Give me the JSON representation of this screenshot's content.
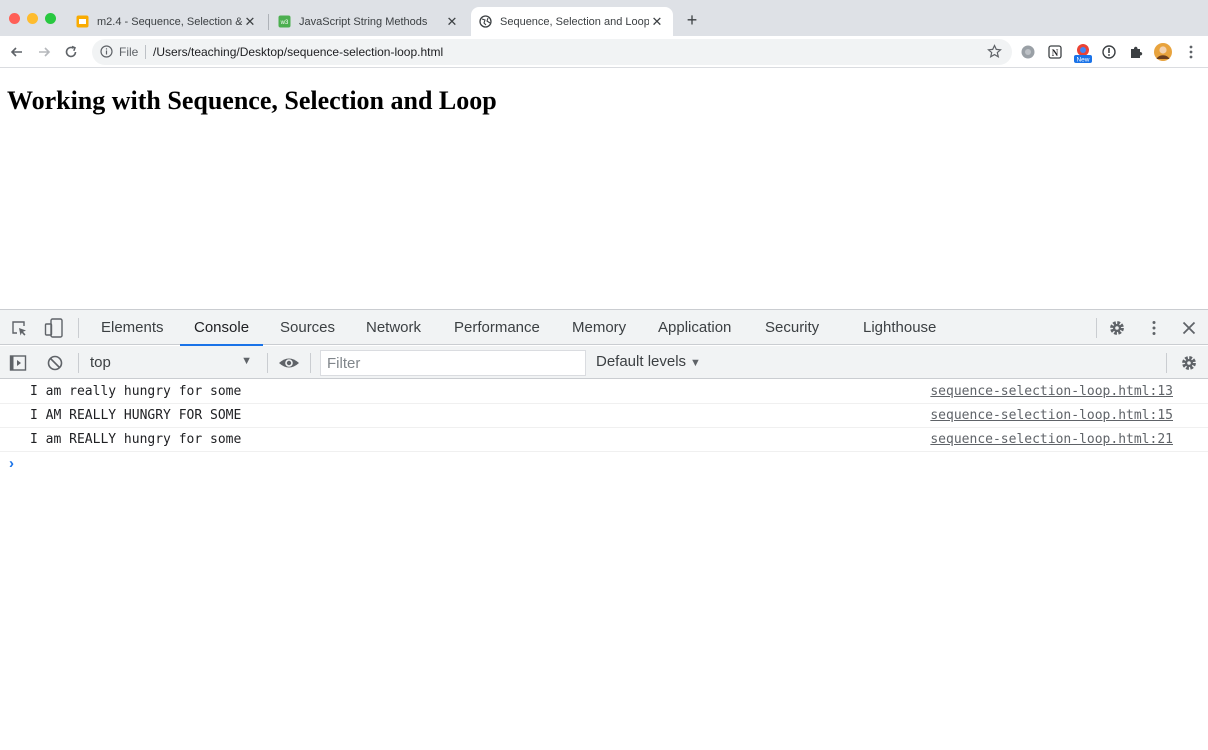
{
  "browser": {
    "tabs": [
      {
        "title": "m2.4 - Sequence, Selection &",
        "favicon": "slides-icon",
        "active": false
      },
      {
        "title": "JavaScript String Methods",
        "favicon": "w3schools-icon",
        "active": false
      },
      {
        "title": "Sequence, Selection and Loop",
        "favicon": "globe-icon",
        "active": true
      }
    ],
    "close_glyph": "✕",
    "new_tab_glyph": "+",
    "address": {
      "scheme_label": "File",
      "url": "/Users/teaching/Desktop/sequence-selection-loop.html"
    },
    "extensions": [
      "extension-circle-icon",
      "notion-icon",
      "extension-new-icon",
      "info-icon",
      "puzzle-icon",
      "profile-avatar",
      "more-icon"
    ],
    "extension_badge": "New"
  },
  "page": {
    "heading": "Working with Sequence, Selection and Loop"
  },
  "devtools": {
    "tabs": [
      "Elements",
      "Console",
      "Sources",
      "Network",
      "Performance",
      "Memory",
      "Application",
      "Security",
      "Lighthouse"
    ],
    "active_tab": "Console",
    "console_toolbar": {
      "context": "top",
      "filter_placeholder": "Filter",
      "levels": "Default levels"
    },
    "logs": [
      {
        "message": "I am really hungry for some",
        "source": "sequence-selection-loop.html:13"
      },
      {
        "message": "I AM REALLY HUNGRY FOR SOME",
        "source": "sequence-selection-loop.html:15"
      },
      {
        "message": "I am REALLY hungry for some",
        "source": "sequence-selection-loop.html:21"
      }
    ],
    "prompt": "›"
  },
  "colors": {
    "accent": "#1a73e8",
    "tabstrip": "#dee1e6",
    "devtools_bar": "#f1f3f4"
  }
}
